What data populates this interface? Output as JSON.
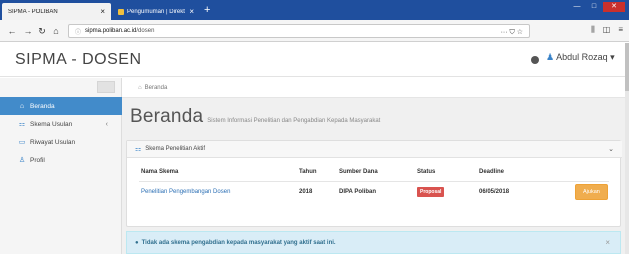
{
  "browser": {
    "tabs": [
      {
        "label": "SIPMA - POLIBAN",
        "close": "×"
      },
      {
        "label": "Pengumuman | Direktorat Jende",
        "close": "×"
      }
    ],
    "new_tab": "+",
    "window_controls": {
      "minimize": "—",
      "maximize": "□",
      "close": "✕"
    },
    "url_domain": "sipma.poliban.ac.id",
    "url_path": "/dosen",
    "url_actions": "··· ⛉ ☆"
  },
  "header": {
    "brand": "SIPMA - DOSEN",
    "user": "Abdul Rozaq"
  },
  "sidebar": {
    "items": [
      {
        "label": "Beranda",
        "icon": "home-icon"
      },
      {
        "label": "Skema Usulan",
        "icon": "sitemap-icon",
        "caret": "‹"
      },
      {
        "label": "Riwayat Usulan",
        "icon": "folder-icon"
      },
      {
        "label": "Profil",
        "icon": "users-icon"
      }
    ]
  },
  "breadcrumb": {
    "label": "Beranda"
  },
  "page": {
    "title": "Beranda",
    "subtitle": "Sistem Informasi Penelitian dan Pengabdian Kepada Masyarakat"
  },
  "panel": {
    "title": "Skema Penelitian Aktif",
    "columns": [
      "Nama Skema",
      "Tahun",
      "Sumber Dana",
      "Status",
      "Deadline"
    ],
    "rows": [
      {
        "name": "Penelitian Pengembangan Dosen",
        "year": "2018",
        "fund": "DIPA Poliban",
        "status": "Proposal",
        "deadline": "06/05/2018",
        "action": "Ajukan"
      }
    ]
  },
  "alert": {
    "text": "Tidak ada skema pengabdian kepada masyarakat yang aktif saat ini.",
    "dismiss": "×"
  },
  "colors": {
    "tabstrip": "#1f4f9e",
    "sidebar_active": "#428bca",
    "badge": "#d9534f",
    "button_warning": "#f0ad4e",
    "alert_bg": "#d9edf7"
  }
}
